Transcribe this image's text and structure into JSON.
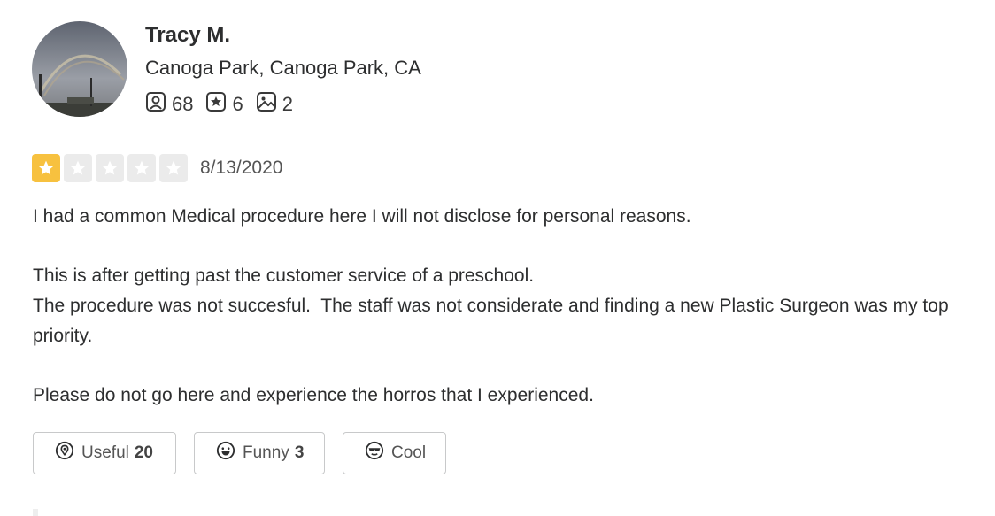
{
  "user": {
    "name": "Tracy M.",
    "location": "Canoga Park, Canoga Park, CA",
    "stats": [
      {
        "icon": "friends-icon",
        "value": "68"
      },
      {
        "icon": "reviews-star-icon",
        "value": "6"
      },
      {
        "icon": "photos-icon",
        "value": "2"
      }
    ]
  },
  "review": {
    "rating": 1,
    "rating_max": 5,
    "date": "8/13/2020",
    "paragraphs": [
      "I had a common Medical procedure here I will not disclose for personal reasons.",
      "This is after getting past the customer service of a preschool.",
      "The procedure was not succesful.  The staff was not considerate and finding a new Plastic Surgeon was my top priority.",
      "Please do not go here and experience the horros that I experienced."
    ]
  },
  "reactions": {
    "useful": {
      "label": "Useful",
      "count": "20",
      "icon": "lightbulb-icon"
    },
    "funny": {
      "label": "Funny",
      "count": "3",
      "icon": "smile-icon"
    },
    "cool": {
      "label": "Cool",
      "count": "",
      "icon": "sunglasses-icon"
    }
  },
  "colors": {
    "star_filled": "#f7c13f",
    "star_empty": "#ebebeb",
    "text": "#2d2e2f"
  }
}
